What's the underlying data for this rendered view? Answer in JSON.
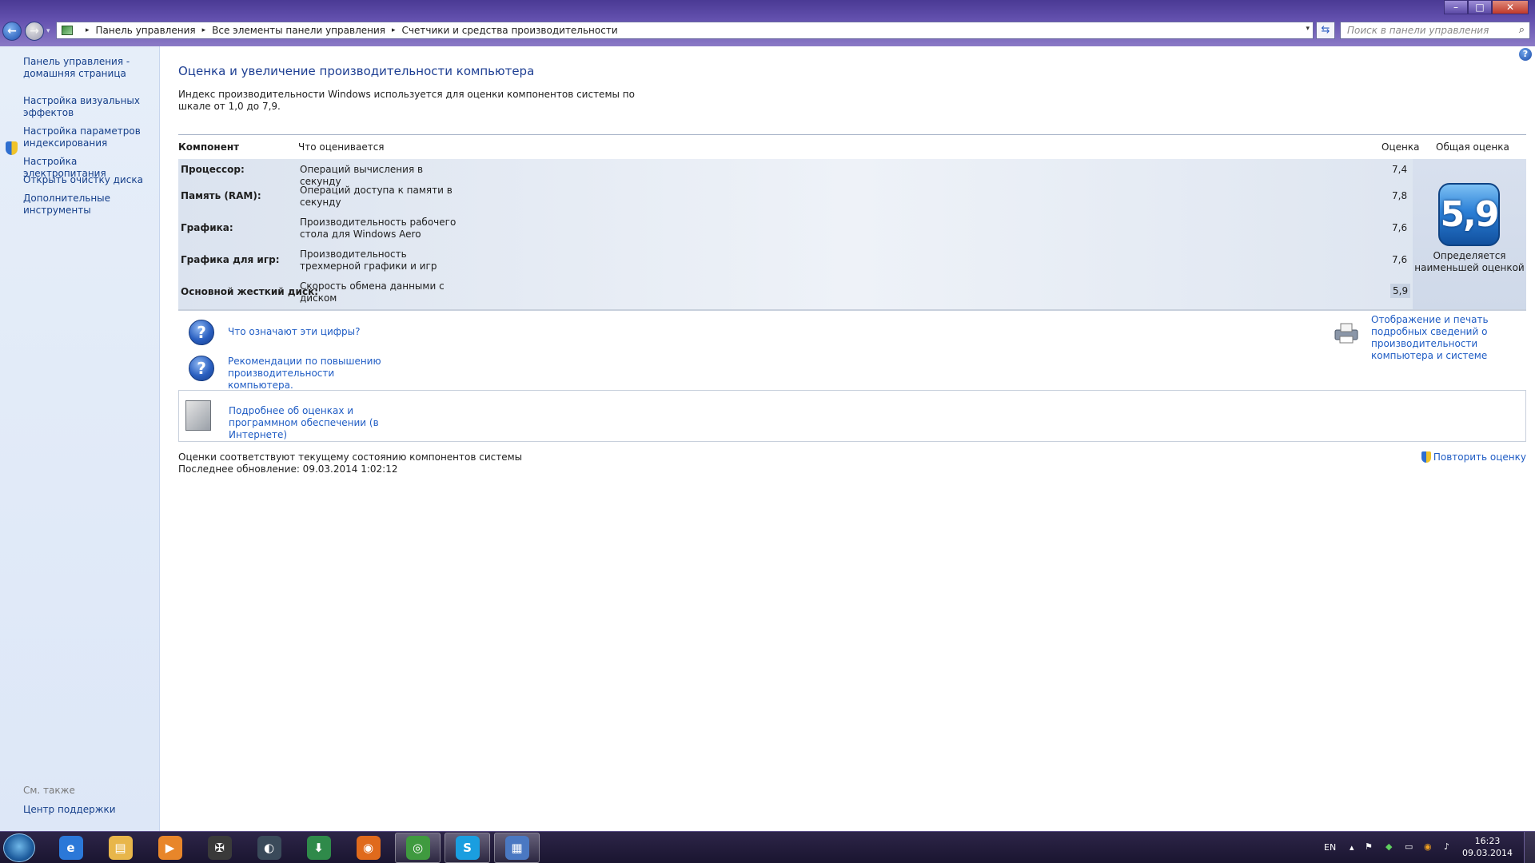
{
  "window": {
    "min_glyph": "–",
    "max_glyph": "□",
    "close_glyph": "✕"
  },
  "nav": {
    "back_glyph": "←",
    "forward_glyph": "→",
    "history_glyph": "▾"
  },
  "address": {
    "crumbs": [
      "Панель управления",
      "Все элементы панели управления",
      "Счетчики и средства производительности"
    ],
    "separator": "▸",
    "dropdown_glyph": "▾",
    "refresh_glyph": "⇆"
  },
  "search": {
    "placeholder": "Поиск в панели управления",
    "icon_glyph": "⌕"
  },
  "sidebar": {
    "home_link": "Панель управления - домашняя страница",
    "items": [
      "Настройка визуальных эффектов",
      "Настройка параметров индексирования",
      "Настройка электропитания",
      "Открыть очистку диска",
      "Дополнительные инструменты"
    ],
    "see_also_heading": "См. также",
    "see_also_items": [
      "Центр поддержки"
    ]
  },
  "main": {
    "help_glyph": "?",
    "title": "Оценка и увеличение производительности компьютера",
    "intro": "Индекс производительности Windows используется для оценки компонентов системы по шкале от 1,0 до 7,9.",
    "table": {
      "headers": {
        "component": "Компонент",
        "what": "Что оценивается",
        "score": "Оценка",
        "base": "Общая оценка"
      },
      "rows": [
        {
          "component": "Процессор:",
          "what": "Операций вычисления в секунду",
          "score": "7,4"
        },
        {
          "component": "Память (RAM):",
          "what": "Операций доступа к памяти в секунду",
          "score": "7,8"
        },
        {
          "component": "Графика:",
          "what": "Производительность рабочего стола для Windows Aero",
          "score": "7,6"
        },
        {
          "component": "Графика для игр:",
          "what": "Производительность трехмерной графики и игр",
          "score": "7,6"
        },
        {
          "component": "Основной жесткий диск:",
          "what": "Скорость обмена данными с диском",
          "score": "5,9"
        }
      ],
      "base_score": "5,9",
      "base_caption": "Определяется наименьшей оценкой"
    },
    "links": {
      "what_numbers_mean": "Что означают эти цифры?",
      "tips": "Рекомендации по повышению производительности компьютера.",
      "print_details": "Отображение и печать подробных сведений о производительности компьютера и системе",
      "online_info": "Подробнее об оценках и программном обеспечении (в Интернете)"
    },
    "question_glyph": "?",
    "status_line1": "Оценки соответствуют текущему состоянию компонентов системы",
    "status_line2": "Последнее обновление: 09.03.2014 1:02:12",
    "rerun": "Повторить оценку"
  },
  "taskbar": {
    "pinned": [
      {
        "name": "internet-explorer",
        "glyph": "e",
        "color": "#2b78d8"
      },
      {
        "name": "windows-explorer",
        "glyph": "▤",
        "color": "#e8b64a"
      },
      {
        "name": "media-player",
        "glyph": "▶",
        "color": "#e8862a"
      },
      {
        "name": "game-app",
        "glyph": "✠",
        "color": "#3a3a3a"
      },
      {
        "name": "media-app",
        "glyph": "◐",
        "color": "#3a4a5a"
      },
      {
        "name": "download-app",
        "glyph": "⬇",
        "color": "#2f8a4a"
      },
      {
        "name": "firefox",
        "glyph": "◉",
        "color": "#e06a1c"
      },
      {
        "name": "chrome",
        "glyph": "◎",
        "color": "#3f9a3f"
      },
      {
        "name": "skype",
        "glyph": "S",
        "color": "#1a9ee0"
      },
      {
        "name": "control-panel",
        "glyph": "▦",
        "color": "#4a78c2"
      }
    ],
    "language": "EN",
    "tray_up_glyph": "▴",
    "tray_glyphs": [
      "⚑",
      "◆",
      "▭",
      "◉",
      "♪"
    ],
    "time": "16:23",
    "date": "09.03.2014"
  }
}
